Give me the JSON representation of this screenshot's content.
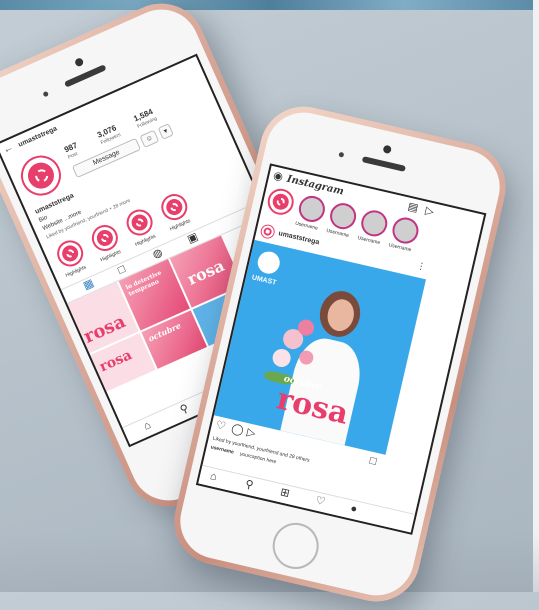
{
  "left_phone": {
    "username": "umaststrega",
    "stats": [
      {
        "value": "987",
        "label": "Post"
      },
      {
        "value": "3,076",
        "label": "Followers"
      },
      {
        "value": "1,584",
        "label": "Following"
      }
    ],
    "message_label": "Message",
    "bio_name": "umaststrega",
    "bio_line1": "Bio",
    "bio_line2": "Website ...more",
    "bio_line3": "Liked by yourfriend, yourfriend + 28 more",
    "highlights": [
      "Highlights",
      "Highlights",
      "Highlights",
      "Highlights"
    ],
    "tile_texts": [
      "lo detertive temprano",
      "rosa",
      "rosa",
      "rosa",
      "octubre"
    ]
  },
  "right_phone": {
    "app_name": "Instagram",
    "stories": [
      "Username",
      "Username",
      "Username",
      "Username"
    ],
    "post_user": "umaststrega",
    "brand": "UMAST",
    "post_word": "rosa",
    "post_word_small": "octubre",
    "likes_text": "Liked by yourfriend, yourfriend and 28 others",
    "caption_user": "username",
    "caption_text": "yourcaption here"
  },
  "colors": {
    "brand_pink": "#e83e6c",
    "post_blue": "#38a8ea",
    "phone_rose_gold": "#d9a99a",
    "background": "#b7c2cb"
  }
}
